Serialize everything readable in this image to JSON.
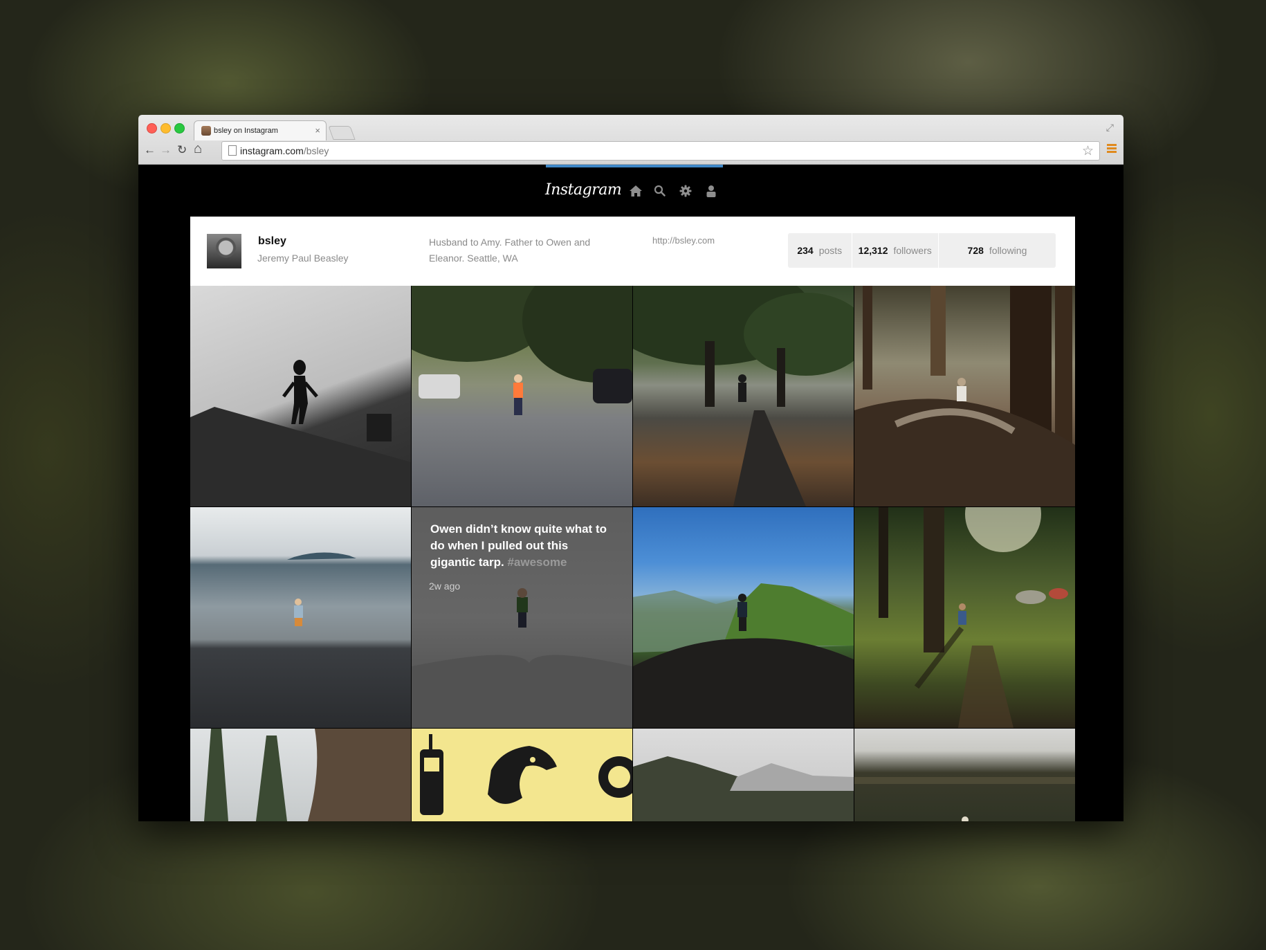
{
  "browser": {
    "tab_title": "bsley on Instagram",
    "tab_close": "×",
    "url_host": "instagram.com",
    "url_path": "/bsley",
    "back": "←",
    "forward": "→",
    "reload": "↻",
    "home": "⌂",
    "star": "☆",
    "fullscreen": "⤢"
  },
  "nav": {
    "logo": "Instagram",
    "icons": [
      "home-icon",
      "search-icon",
      "gear-icon",
      "user-icon"
    ]
  },
  "profile": {
    "username": "bsley",
    "full_name": "Jeremy Paul Beasley",
    "bio": "Husband to Amy. Father to Owen and Eleanor. Seattle, WA",
    "website": "http://bsley.com",
    "stats": {
      "posts_count": "234",
      "posts_label": "posts",
      "followers_count": "12,312",
      "followers_label": "followers",
      "following_count": "728",
      "following_label": "following"
    }
  },
  "hover_post": {
    "caption": "Owen didn’t know quite what to do when I pulled out this gigantic tarp.",
    "hashtag": "#awesome",
    "time": "2w ago"
  }
}
